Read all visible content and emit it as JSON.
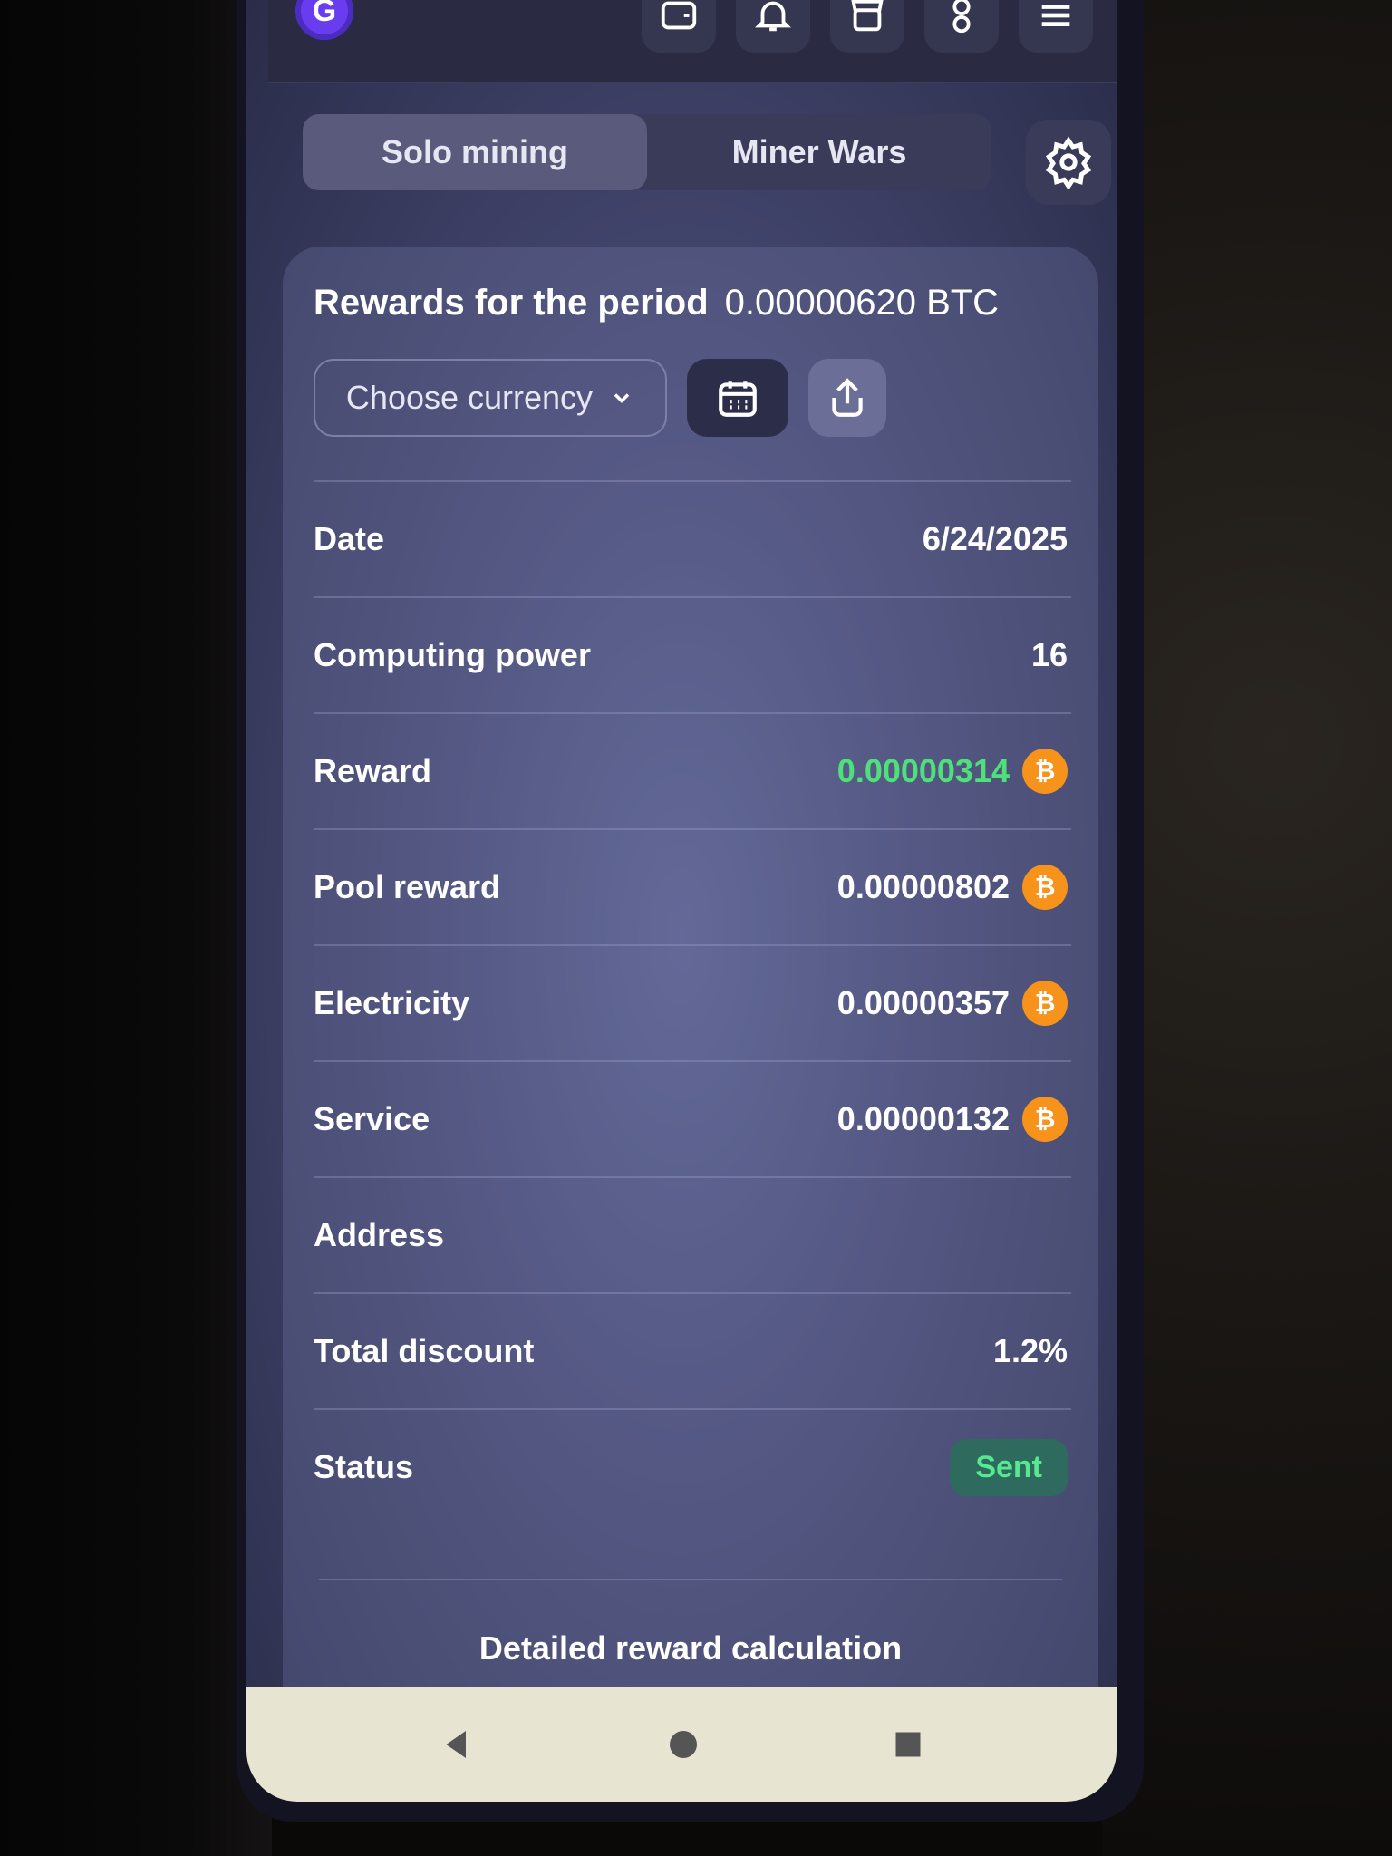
{
  "app": {
    "logo_letter": "G"
  },
  "topbar": {
    "icons": [
      "wallet-icon",
      "bell-icon",
      "store-icon",
      "user-icon",
      "menu-icon"
    ]
  },
  "tabs": [
    {
      "label": "Solo mining",
      "active": true
    },
    {
      "label": "Miner Wars",
      "active": false
    }
  ],
  "card": {
    "period_label": "Rewards for the period",
    "period_value": "0.00000620 BTC",
    "currency_placeholder": "Choose currency",
    "rows": {
      "date": {
        "label": "Date",
        "value": "6/24/2025"
      },
      "computing_power": {
        "label": "Computing power",
        "value": "16"
      },
      "reward": {
        "label": "Reward",
        "value": "0.00000314"
      },
      "pool_reward": {
        "label": "Pool reward",
        "value": "0.00000802"
      },
      "electricity": {
        "label": "Electricity",
        "value": "0.00000357"
      },
      "service": {
        "label": "Service",
        "value": "0.00000132"
      },
      "address": {
        "label": "Address",
        "value": ""
      },
      "total_discount": {
        "label": "Total discount",
        "value": "1.2%"
      },
      "status": {
        "label": "Status",
        "value": "Sent"
      }
    },
    "detail_link": "Detailed reward calculation"
  },
  "colors": {
    "accent": "#6a3cf0",
    "reward_green": "#4ee07a",
    "btc_orange": "#f7931a",
    "status_bg": "#2e6b5e"
  }
}
